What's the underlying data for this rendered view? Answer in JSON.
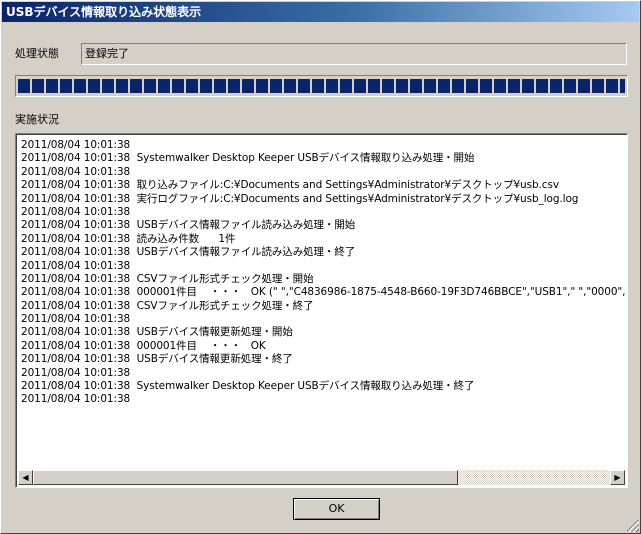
{
  "window": {
    "title": "USBデバイス情報取り込み状態表示"
  },
  "status": {
    "label": "処理状態",
    "value": "登録完了"
  },
  "progress": {
    "percent": 100
  },
  "log": {
    "label": "実施状況",
    "lines": [
      "2011/08/04 10:01:38",
      "2011/08/04 10:01:38  Systemwalker Desktop Keeper USBデバイス情報取り込み処理・開始",
      "2011/08/04 10:01:38",
      "2011/08/04 10:01:38  取り込みファイル:C:¥Documents and Settings¥Administrator¥デスクトップ¥usb.csv",
      "2011/08/04 10:01:38  実行ログファイル:C:¥Documents and Settings¥Administrator¥デスクトップ¥usb_log.log",
      "2011/08/04 10:01:38",
      "2011/08/04 10:01:38  USBデバイス情報ファイル読み込み処理・開始",
      "2011/08/04 10:01:38  読み込み件数      1件",
      "2011/08/04 10:01:38  USBデバイス情報ファイル読み込み処理・終了",
      "2011/08/04 10:01:38",
      "2011/08/04 10:01:38  CSVファイル形式チェック処理・開始",
      "2011/08/04 10:01:38  000001件目    ・・・   OK (\" \",\"C4836986-1875-4548-B660-19F3D746BBCE\",\"USB1\",\" \",\"0000\",\"0",
      "2011/08/04 10:01:38  CSVファイル形式チェック処理・終了",
      "2011/08/04 10:01:38",
      "2011/08/04 10:01:38  USBデバイス情報更新処理・開始",
      "2011/08/04 10:01:38  000001件目    ・・・   OK",
      "2011/08/04 10:01:38  USBデバイス情報更新処理・終了",
      "2011/08/04 10:01:38",
      "2011/08/04 10:01:38  Systemwalker Desktop Keeper USBデバイス情報取り込み処理・終了",
      "2011/08/04 10:01:38"
    ]
  },
  "buttons": {
    "ok_label": "OK"
  },
  "icons": {
    "scroll_left": "scroll-left-arrow-icon",
    "scroll_right": "scroll-right-arrow-icon",
    "scroll_left_glyph": "◀",
    "scroll_right_glyph": "▶"
  }
}
